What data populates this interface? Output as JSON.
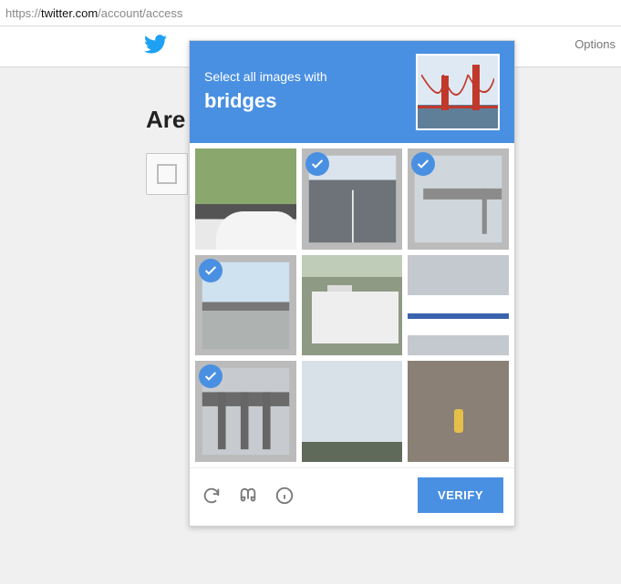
{
  "address_bar": {
    "scheme": "https://",
    "host": "twitter.com",
    "path": "/account/access"
  },
  "header": {
    "options_label": "Options"
  },
  "page": {
    "heading_visible": "Are"
  },
  "captcha": {
    "instruction_prefix": "Select all images with",
    "instruction_target": "bridges",
    "example_icon": "golden-gate-bridge",
    "verify_label": "VERIFY",
    "footer_icons": [
      "reload",
      "audio",
      "info"
    ],
    "tiles": [
      {
        "id": 0,
        "selected": false,
        "desc": "grass-curb-car"
      },
      {
        "id": 1,
        "selected": true,
        "desc": "highway-overpass"
      },
      {
        "id": 2,
        "selected": true,
        "desc": "overpass-pillar"
      },
      {
        "id": 3,
        "selected": true,
        "desc": "freeway-bridge"
      },
      {
        "id": 4,
        "selected": false,
        "desc": "white-truck-street"
      },
      {
        "id": 5,
        "selected": false,
        "desc": "city-bus"
      },
      {
        "id": 6,
        "selected": true,
        "desc": "elevated-rail"
      },
      {
        "id": 7,
        "selected": false,
        "desc": "cloudy-sky"
      },
      {
        "id": 8,
        "selected": false,
        "desc": "sidewalk-hydrant"
      }
    ]
  }
}
